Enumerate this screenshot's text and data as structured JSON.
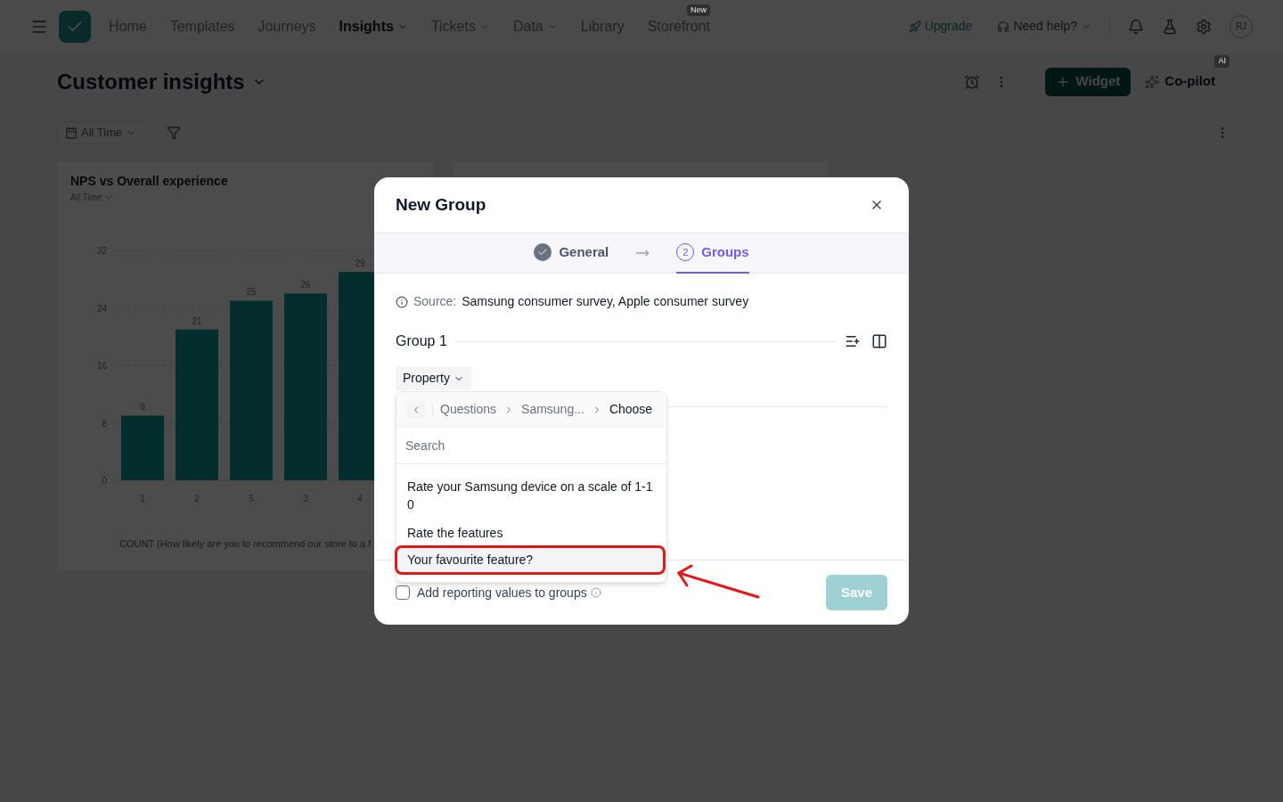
{
  "nav": {
    "items": [
      {
        "label": "Home",
        "selected": false,
        "dropdown": false
      },
      {
        "label": "Templates",
        "selected": false,
        "dropdown": false
      },
      {
        "label": "Journeys",
        "selected": false,
        "dropdown": false
      },
      {
        "label": "Insights",
        "selected": true,
        "dropdown": true
      },
      {
        "label": "Tickets",
        "selected": false,
        "dropdown": true
      },
      {
        "label": "Data",
        "selected": false,
        "dropdown": true
      },
      {
        "label": "Library",
        "selected": false,
        "dropdown": false
      },
      {
        "label": "Storefront",
        "selected": false,
        "dropdown": false,
        "badge": "New"
      }
    ],
    "upgrade": "Upgrade",
    "help": "Need help?",
    "avatar": "RJ"
  },
  "page": {
    "title": "Customer insights",
    "widget_button": "Widget",
    "copilot": "Co-pilot",
    "copilot_badge": "AI",
    "time_filter": "All Time"
  },
  "chart_card": {
    "title": "NPS vs Overall experience",
    "period": "All Time",
    "chart_data": {
      "type": "bar",
      "categories": [
        "1",
        "2",
        "5",
        "3",
        "4"
      ],
      "series": [
        {
          "name": "COUNT (How likely are you to recommend our store to a f",
          "color": "#0e9a98",
          "values": [
            9,
            21,
            25,
            26,
            29
          ]
        }
      ],
      "ylim": [
        0,
        32
      ],
      "yticks": [
        0,
        8,
        16,
        24,
        32
      ],
      "data_labels": true,
      "grid": true
    }
  },
  "dialog": {
    "title": "New Group",
    "steps": [
      {
        "label": "General",
        "done": true,
        "selected": false
      },
      {
        "label": "Groups",
        "done": false,
        "number": "2",
        "selected": true
      }
    ],
    "source_label": "Source:",
    "source": "Samsung consumer survey, Apple consumer survey",
    "group_title": "Group 1",
    "property_button": "Property",
    "dropdown": {
      "breadcrumb": [
        {
          "label": "Questions",
          "current": false
        },
        {
          "label": "Samsung...",
          "current": false
        },
        {
          "label": "Choose",
          "current": true
        }
      ],
      "search_placeholder": "Search",
      "options": [
        {
          "label": "Rate your Samsung device on a scale of 1-10",
          "highlighted": false
        },
        {
          "label": "Rate the features",
          "highlighted": false
        },
        {
          "label": "Your favourite feature?",
          "highlighted": true
        }
      ]
    },
    "checkbox": {
      "label": "Add reporting values to groups",
      "checked": false
    },
    "save": {
      "label": "Save",
      "disabled": true
    }
  }
}
